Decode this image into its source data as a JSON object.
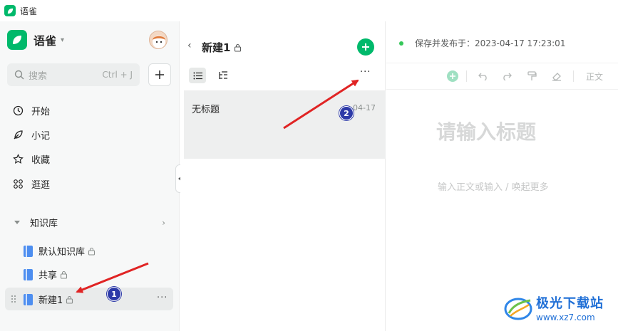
{
  "window": {
    "title": "语雀"
  },
  "sidebar": {
    "brand_name": "语雀",
    "search_placeholder": "搜索",
    "search_shortcut": "Ctrl + J",
    "nav": [
      {
        "label": "开始",
        "icon": "clock-icon"
      },
      {
        "label": "小记",
        "icon": "feather-icon"
      },
      {
        "label": "收藏",
        "icon": "star-icon"
      },
      {
        "label": "逛逛",
        "icon": "grid-icon"
      }
    ],
    "section_label": "知识库",
    "repos": [
      {
        "label": "默认知识库",
        "locked": true
      },
      {
        "label": "共享",
        "locked": true
      },
      {
        "label": "新建1",
        "locked": true,
        "active": true
      }
    ],
    "more_label": "···"
  },
  "middle": {
    "title": "新建1",
    "more_label": "···",
    "doc": {
      "title": "无标题",
      "date": "04-17"
    }
  },
  "editor": {
    "status": "保存并发布于：2023-04-17 17:23:01",
    "text_style": "正文",
    "title_placeholder": "请输入标题",
    "body_placeholder": "输入正文或输入 / 唤起更多"
  },
  "annotations": [
    {
      "number": "1"
    },
    {
      "number": "2"
    }
  ],
  "watermark": {
    "name": "极光下载站",
    "url": "www.xz7.com"
  },
  "colors": {
    "brand": "#00b96b",
    "arrow": "#e02424",
    "badge": "#2d3aa8"
  }
}
